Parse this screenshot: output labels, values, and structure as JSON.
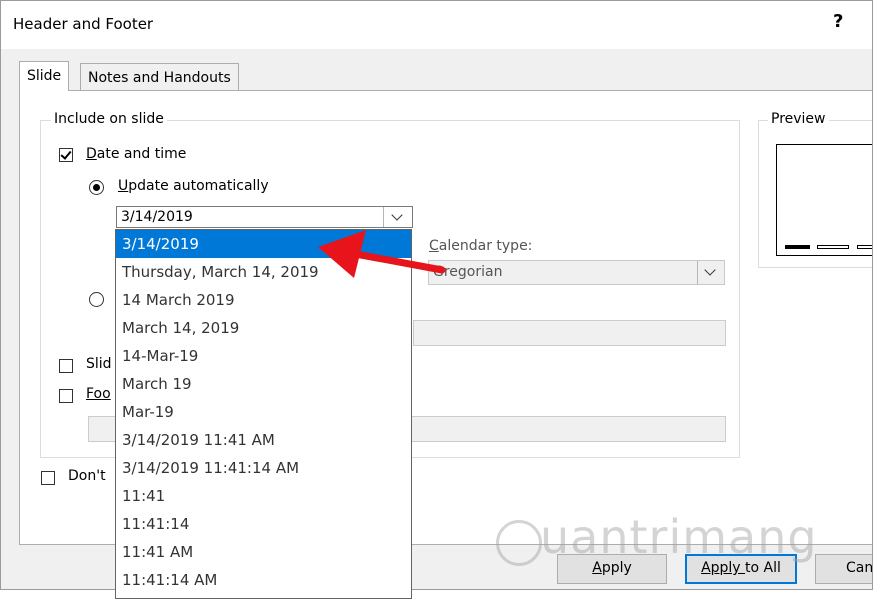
{
  "dialog": {
    "title": "Header and Footer",
    "help_symbol": "?"
  },
  "tabs": [
    {
      "label": "Slide",
      "active": true
    },
    {
      "label": "Notes and Handouts",
      "active": false
    }
  ],
  "include_group": {
    "legend": "Include on slide",
    "date_and_time": {
      "label_underlined": "D",
      "label_rest": "ate and time",
      "checked": true
    },
    "update_automatically": {
      "label_underlined": "U",
      "label_rest": "pdate automatically",
      "selected": true
    },
    "date_combo_value": "3/14/2019",
    "calendar_type": {
      "label_underlined": "C",
      "label_rest": "alendar type:",
      "value": "Gregorian"
    },
    "slide_number": {
      "label_underlined": "",
      "label_visible": "Slid",
      "checked": false
    },
    "footer": {
      "label_underlined": "Foo",
      "checked": false
    }
  },
  "dont_show": {
    "label_visible": "Don't",
    "checked": false
  },
  "preview": {
    "legend": "Preview"
  },
  "date_options": [
    "3/14/2019",
    "Thursday, March 14, 2019",
    "14 March 2019",
    "March 14, 2019",
    "14-Mar-19",
    "March 19",
    "Mar-19",
    "3/14/2019 11:41 AM",
    "3/14/2019 11:41:14 AM",
    "11:41",
    "11:41:14",
    "11:41 AM",
    "11:41:14 AM"
  ],
  "selected_option_index": 0,
  "buttons": {
    "apply_underlined": "A",
    "apply_rest": "pply",
    "apply_all_underlined": "Apply ",
    "apply_all_rest": "to All",
    "cancel_visible": "Can"
  },
  "watermark": {
    "text": "uantrimang"
  },
  "colors": {
    "selection": "#0078d7",
    "arrow": "#e8141b",
    "dialog_bg": "#f0f0f0"
  }
}
